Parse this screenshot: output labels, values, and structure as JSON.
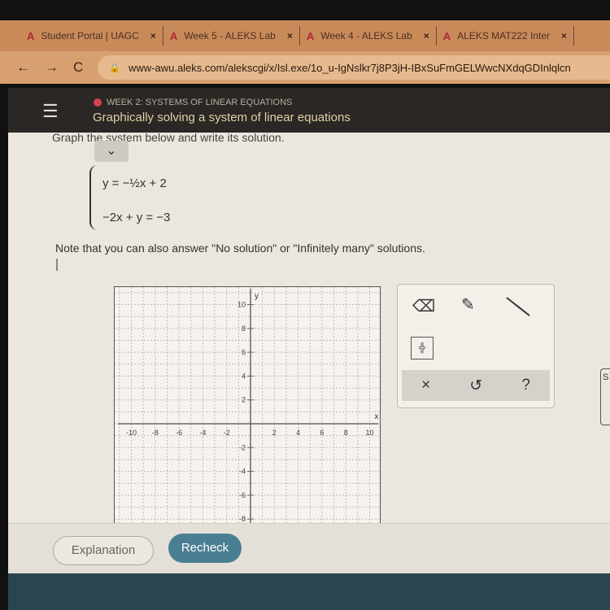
{
  "browser": {
    "tabs": [
      {
        "label": "Student Portal | UAGC"
      },
      {
        "label": "Week 5 - ALEKS Lab"
      },
      {
        "label": "Week 4 - ALEKS Lab"
      },
      {
        "label": "ALEKS MAT222 Inter"
      }
    ],
    "url": "www-awu.aleks.com/alekscgi/x/Isl.exe/1o_u-IgNslkr7j8P3jH-IBxSuFmGELWwcNXdqGDInlqlcn"
  },
  "header": {
    "week": "WEEK 2: SYSTEMS OF LINEAR EQUATIONS",
    "topic": "Graphically solving a system of linear equations",
    "status_color": "#d84050"
  },
  "problem": {
    "instruction": "Graph the system below and write its solution.",
    "eq1": "y = −½x + 2",
    "eq2": "−2x + y = −3",
    "note": "Note that you can also answer \"No solution\" or \"Infinitely many\" solutions."
  },
  "graph": {
    "x_label": "x",
    "y_label": "y",
    "xlim": [
      -11,
      11
    ],
    "ylim": [
      -8.5,
      11
    ],
    "x_ticks": [
      "-10",
      "-8",
      "-6",
      "-4",
      "-2",
      "2",
      "4",
      "6",
      "8",
      "10"
    ],
    "y_ticks": [
      "10",
      "8",
      "6",
      "4",
      "2",
      "-2",
      "-4",
      "-6",
      "-8"
    ]
  },
  "tools": {
    "eraser": "eraser-icon",
    "pencil": "pencil-icon",
    "line": "line-icon",
    "no_solution": "no-solution-icon",
    "clear": "×",
    "undo": "↺",
    "help": "?"
  },
  "side_label": "S",
  "footer": {
    "explanation": "Explanation",
    "recheck": "Recheck"
  }
}
